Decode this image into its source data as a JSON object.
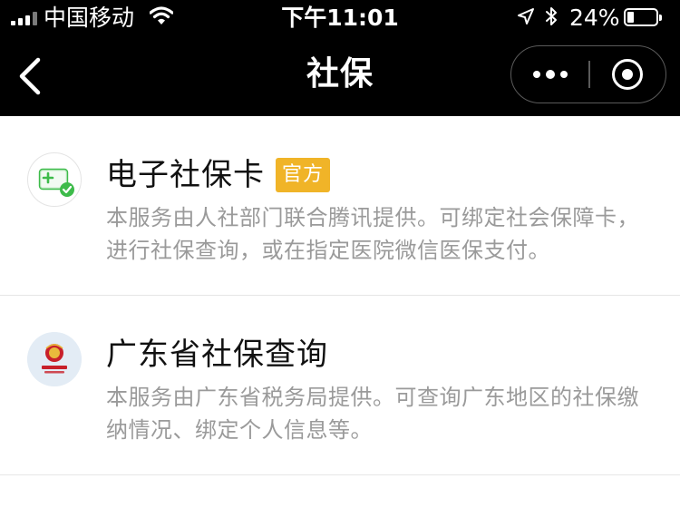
{
  "status_bar": {
    "carrier": "中国移动",
    "time": "下午11:01",
    "battery_percent": "24%",
    "battery_level": 0.24,
    "icons": [
      "signal-icon",
      "wifi-icon",
      "location-icon",
      "bluetooth-icon",
      "battery-icon"
    ]
  },
  "nav": {
    "title": "社保",
    "back_icon": "chevron-left-icon",
    "more_icon": "more-dots-icon",
    "close_icon": "target-circle-icon"
  },
  "colors": {
    "header_bg": "#000000",
    "badge_bg": "#f0b428",
    "title_text": "#111111",
    "desc_text": "#9a9a9a",
    "card_icon_green": "#3dbb4a"
  },
  "services": [
    {
      "title": "电子社保卡",
      "badge": "官方",
      "description": "本服务由人社部门联合腾讯提供。可绑定社会保障卡，进行社保查询，或在指定医院微信医保支付。",
      "logo_icon": "social-security-card-icon"
    },
    {
      "title": "广东省社保查询",
      "badge": "",
      "description": "本服务由广东省税务局提供。可查询广东地区的社保缴纳情况、绑定个人信息等。",
      "logo_icon": "tax-bureau-emblem-icon"
    }
  ]
}
